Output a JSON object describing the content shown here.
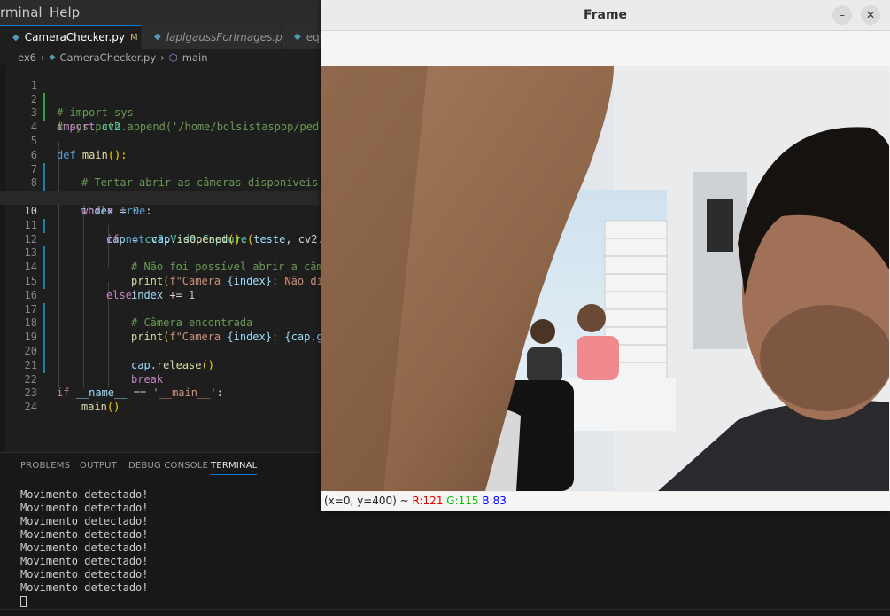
{
  "menubar": {
    "items": [
      "rminal",
      "Help"
    ]
  },
  "tabs": [
    {
      "label": "CameraChecker.py",
      "modified": "M",
      "active": true
    },
    {
      "label": "laplgaussForImages.py",
      "active": false
    },
    {
      "label": "equ",
      "active": false
    }
  ],
  "breadcrumb": {
    "folder": "ex6",
    "file": "CameraChecker.py",
    "symbol": "main"
  },
  "editor": {
    "current_line": 10,
    "line_numbers": [
      "1",
      "2",
      "3",
      "4",
      "5",
      "6",
      "7",
      "8",
      "9",
      "10",
      "11",
      "12",
      "13",
      "14",
      "15",
      "16",
      "17",
      "18",
      "19",
      "20",
      "21",
      "22",
      "23",
      "24"
    ],
    "lines": {
      "l1": "# import sys",
      "l2": "# sys.path.append('/home/bolsistaspop/pedro",
      "l3_kw": "import",
      "l3_mod": " cv2",
      "l5_kw": "def",
      "l5_fn": " main",
      "l5_p": "():",
      "l6": "# Tentar abrir as câmeras disponíveis",
      "l7_var": "teste",
      "l7_op": " = ",
      "l7_num": "3",
      "l8_var": "index",
      "l8_op": " = ",
      "l8_num": "0",
      "l9_kw": "while",
      "l9_rest": " True",
      "l9_colon": ":",
      "l10_var": "cap",
      "l10_op": " = ",
      "l10_mod": "cv2",
      "l10_dot": ".",
      "l10_fn": "VideoCapture",
      "l10_p": "(",
      "l10_arg": "teste",
      "l10_rest": ", cv2.C",
      "l11_kw": "if",
      "l11_not": " not ",
      "l11_var": "cap",
      "l11_dot": ".",
      "l11_fn": "isOpened",
      "l11_p": "():",
      "l12": "# Não foi possível abrir a câme",
      "l13_fn": "print",
      "l13_p": "(",
      "l13_str": "f\"Camera ",
      "l13_b": "{index}",
      "l13_str2": ": Não dis",
      "l14_var": "index",
      "l14_op": " += ",
      "l14_num": "1",
      "l15_kw": "else",
      "l15_p": ":",
      "l16": "# Câmera encontrada",
      "l17_fn": "print",
      "l17_p": "(",
      "l17_str": "f\"Camera ",
      "l17_b": "{index}",
      "l17_str2": ": ",
      "l17_b2": "{cap.ge",
      "l19_var": "cap",
      "l19_dot": ".",
      "l19_fn": "release",
      "l19_p": "()",
      "l20_kw": "break",
      "l22_kw": "if",
      "l22_var": " __name__",
      "l22_op": " == ",
      "l22_str": "'__main__'",
      "l22_colon": ":",
      "l23_fn": "main",
      "l23_p": "()"
    }
  },
  "panel": {
    "tabs": [
      "PROBLEMS",
      "OUTPUT",
      "DEBUG CONSOLE",
      "TERMINAL"
    ],
    "active_tab": "TERMINAL",
    "terminal_lines": [
      "Movimento detectado!",
      "Movimento detectado!",
      "Movimento detectado!",
      "Movimento detectado!",
      "Movimento detectado!",
      "Movimento detectado!",
      "Movimento detectado!",
      "Movimento detectado!"
    ]
  },
  "frame_window": {
    "title": "Frame",
    "minimize_icon": "–",
    "close_icon": "✕",
    "status": {
      "coords": "(x=0, y=400) ~ ",
      "r": "R:121",
      "g": "G:115",
      "b": "B:83"
    },
    "colors": {
      "r": "#ff0000",
      "g": "#00c000",
      "b": "#0000ff"
    }
  },
  "colors": {
    "accent": "#0078d4",
    "editor_bg": "#1e1e1e"
  }
}
